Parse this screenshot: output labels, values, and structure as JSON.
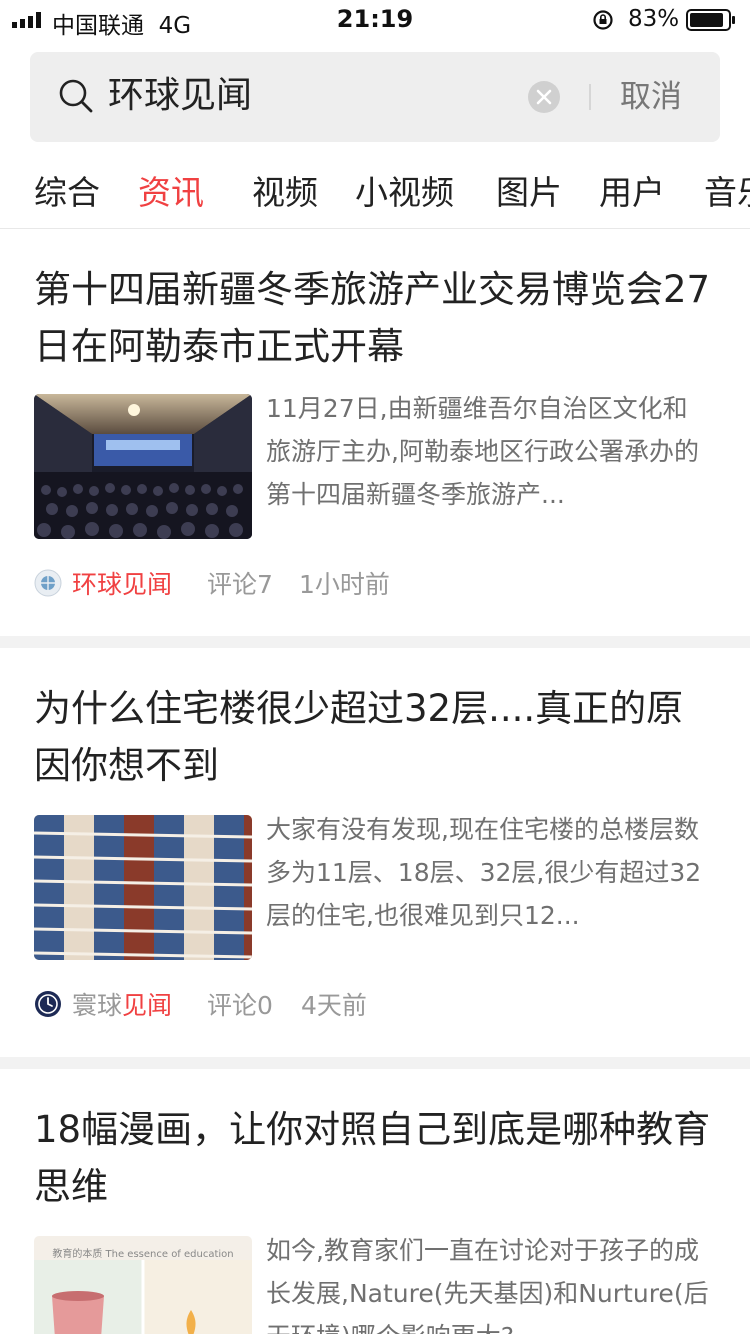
{
  "status_bar": {
    "carrier": "中国联通",
    "network": "4G",
    "time": "21:19",
    "battery": "83%"
  },
  "search": {
    "query": "环球见闻",
    "cancel_label": "取消"
  },
  "tabs": [
    "综合",
    "资讯",
    "视频",
    "小视频",
    "图片",
    "用户",
    "音乐"
  ],
  "active_tab": "资讯",
  "articles": [
    {
      "title": "第十四届新疆冬季旅游产业交易博览会27日在阿勒泰市正式开幕",
      "summary": "11月27日,由新疆维吾尔自治区文化和旅游厅主办,阿勒泰地区行政公署承办的第十四届新疆冬季旅游产...",
      "source": "环球见闻",
      "comments": "评论7",
      "time": "1小时前"
    },
    {
      "title": "为什么住宅楼很少超过32层....真正的原因你想不到",
      "summary": "大家有没有发现,现在住宅楼的总楼层数多为11层、18层、32层,很少有超过32层的住宅,也很难见到只12...",
      "source_prefix": "寰球",
      "source_highlight": "见闻",
      "comments": "评论0",
      "time": "4天前"
    },
    {
      "title": "18幅漫画，让你对照自己到底是哪种教育思维",
      "summary": "如今,教育家们一直在讨论对于孩子的成长发展,Nature(先天基因)和Nurture(后天环境)哪个影响更大?",
      "thumb_caption": "教育的本质 The essence of education"
    }
  ]
}
